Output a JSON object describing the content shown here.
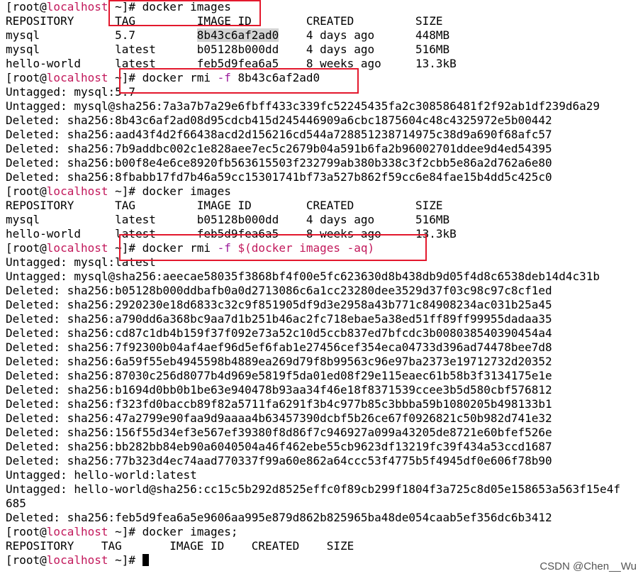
{
  "prompt": {
    "user": "[root@",
    "host": "localhost",
    "suffix": " ~]#"
  },
  "lines": [
    {
      "kind": "prompt",
      "cmd": " docker images"
    },
    {
      "kind": "text",
      "text": "REPOSITORY      TAG         IMAGE ID        CREATED         SIZE"
    },
    {
      "kind": "text",
      "text": "mysql           5.7         ",
      "hl": "8b43c6af2ad0",
      "rest": "    4 days ago      448MB"
    },
    {
      "kind": "text",
      "text": "mysql           latest      b05128b000dd    4 days ago      516MB"
    },
    {
      "kind": "text",
      "text": "hello-world     latest      feb5d9fea6a5    8 weeks ago     13.3kB"
    },
    {
      "kind": "prompt",
      "cmd": " docker rmi ",
      "opt": "-f",
      "rest": " 8b43c6af2ad0"
    },
    {
      "kind": "text",
      "text": "Untagged: mysql:5.7"
    },
    {
      "kind": "text",
      "text": "Untagged: mysql@sha256:7a3a7b7a29e6fbff433c339fc52245435fa2c308586481f2f92ab1df239d6a29"
    },
    {
      "kind": "text",
      "text": "Deleted: sha256:8b43c6af2ad08d95cdcb415d245446909a6cbc1875604c48c4325972e5b00442"
    },
    {
      "kind": "text",
      "text": "Deleted: sha256:aad43f4d2f66438acd2d156216cd544a728851238714975c38d9a690f68afc57"
    },
    {
      "kind": "text",
      "text": "Deleted: sha256:7b9addbc002c1e828aee7ec5c2679b04a591b6fa2b96002701ddee9d4ed54395"
    },
    {
      "kind": "text",
      "text": "Deleted: sha256:b00f8e4e6ce8920fb563615503f232799ab380b338c3f2cbb5e86a2d762a6e80"
    },
    {
      "kind": "text",
      "text": "Deleted: sha256:8fbabb17fd7b46a59cc15301741bf73a527b862f59cc6e84fae15b4dd5c425c0"
    },
    {
      "kind": "prompt",
      "cmd": " docker images"
    },
    {
      "kind": "text",
      "text": "REPOSITORY      TAG         IMAGE ID        CREATED         SIZE"
    },
    {
      "kind": "text",
      "text": "mysql           latest      b05128b000dd    4 days ago      516MB"
    },
    {
      "kind": "text",
      "text": "hello-world     latest      feb5d9fea6a5    8 weeks ago     13.3kB"
    },
    {
      "kind": "prompt",
      "cmd": " docker rmi ",
      "opt": "-f",
      "sp": " ",
      "subst": "$(docker images -aq)"
    },
    {
      "kind": "text",
      "text": "Untagged: mysql:latest"
    },
    {
      "kind": "text",
      "text": "Untagged: mysql@sha256:aeecae58035f3868bf4f00e5fc623630d8b438db9d05f4d8c6538deb14d4c31b"
    },
    {
      "kind": "text",
      "text": "Deleted: sha256:b05128b000ddbafb0a0d2713086c6a1cc23280dee3529d37f03c98c97c8cf1ed"
    },
    {
      "kind": "text",
      "text": "Deleted: sha256:2920230e18d6833c32c9f851905df9d3e2958a43b771c84908234ac031b25a45"
    },
    {
      "kind": "text",
      "text": "Deleted: sha256:a790dd6a368bc9aa7d1b251b46ac2fc718ebae5a38ed51ff89ff99955dadaa35"
    },
    {
      "kind": "text",
      "text": "Deleted: sha256:cd87c1db4b159f37f092e73a52c10d5ccb837ed7bfcdc3b008038540390454a4"
    },
    {
      "kind": "text",
      "text": "Deleted: sha256:7f92300b04af4aef96d5ef6fab1e27456cef354eca04733d396ad74478bee7d8"
    },
    {
      "kind": "text",
      "text": "Deleted: sha256:6a59f55eb4945598b4889ea269d79f8b99563c96e97ba2373e19712732d20352"
    },
    {
      "kind": "text",
      "text": "Deleted: sha256:87030c256d8077b4d969e5819f5da01ed08f29e115eaec61b58b3f3134175e1e"
    },
    {
      "kind": "text",
      "text": "Deleted: sha256:b1694d0bb0b1be63e940478b93aa34f46e18f8371539ccee3b5d580cbf576812"
    },
    {
      "kind": "text",
      "text": "Deleted: sha256:f323fd0baccb89f82a5711fa6291f3b4c977b85c3bbba59b1080205b498133b1"
    },
    {
      "kind": "text",
      "text": "Deleted: sha256:47a2799e90faa9d9aaaa4b63457390dcbf5b26ce67f0926821c50b982d741e32"
    },
    {
      "kind": "text",
      "text": "Deleted: sha256:156f55d34ef3e567ef39380f8d86f7c946927a099a43205de8721e60bfef526e"
    },
    {
      "kind": "text",
      "text": "Deleted: sha256:bb282bb84eb90a6040504a46f462ebe55cb9623df13219fc39f434a53ccd1687"
    },
    {
      "kind": "text",
      "text": "Deleted: sha256:77b323d4ec74aad770337f99a60e862a64ccc53f4775b5f4945df0e606f78b90"
    },
    {
      "kind": "text",
      "text": "Untagged: hello-world:latest"
    },
    {
      "kind": "text",
      "text": "Untagged: hello-world@sha256:cc15c5b292d8525effc0f89cb299f1804f3a725c8d05e158653a563f15e4f"
    },
    {
      "kind": "text",
      "text": "685"
    },
    {
      "kind": "text",
      "text": "Deleted: sha256:feb5d9fea6a5e9606aa995e879d862b825965ba48de054caab5ef356dc6b3412"
    },
    {
      "kind": "prompt",
      "cmd": " docker images;"
    },
    {
      "kind": "text",
      "text": "REPOSITORY    TAG       IMAGE ID    CREATED    SIZE"
    },
    {
      "kind": "prompt",
      "cmd": " ",
      "cursor": true
    }
  ],
  "watermark": "CSDN @Chen__Wu",
  "colors": {
    "background": "#ffffff",
    "text": "#000000",
    "hostname": "#c2185b",
    "option": "#9c1c9c",
    "highlight_box": "#e3182d",
    "selection": "#d4d4d4"
  }
}
